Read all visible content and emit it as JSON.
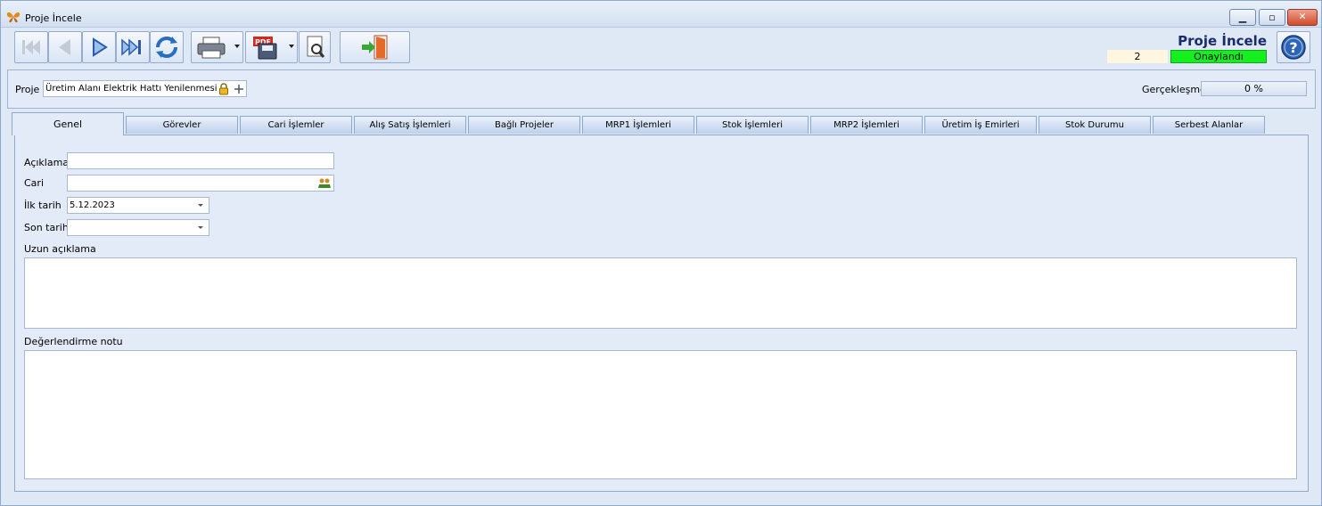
{
  "window": {
    "title": "Proje İncele",
    "icon": "butterfly-icon"
  },
  "toolbar": {
    "buttons": [
      "first-record-icon",
      "prev-record-icon",
      "next-record-icon",
      "last-record-icon",
      "refresh-icon",
      "print-icon",
      "pdf-save-icon",
      "preview-icon",
      "exit-icon"
    ]
  },
  "header": {
    "form_title": "Proje İncele",
    "record_number": "2",
    "status": "Onaylandı",
    "status_color": "#14f01e"
  },
  "project": {
    "label": "Proje",
    "value": "Üretim Alanı Elektrik Hattı Yenilenmesi",
    "progress_label": "Gerçekleşme",
    "progress_value": "0 %"
  },
  "tabs": [
    {
      "label": "Genel",
      "active": true
    },
    {
      "label": "Görevler"
    },
    {
      "label": "Cari İşlemler"
    },
    {
      "label": "Alış Satış İşlemleri"
    },
    {
      "label": "Bağlı Projeler"
    },
    {
      "label": "MRP1 İşlemleri"
    },
    {
      "label": "Stok İşlemleri"
    },
    {
      "label": "MRP2 İşlemleri"
    },
    {
      "label": "Üretim İş Emirleri"
    },
    {
      "label": "Stok Durumu"
    },
    {
      "label": "Serbest Alanlar"
    }
  ],
  "general": {
    "aciklama_label": "Açıklama",
    "aciklama_value": "",
    "cari_label": "Cari",
    "cari_value": "",
    "ilk_tarih_label": "İlk tarih",
    "ilk_tarih_value": "5.12.2023",
    "son_tarih_label": "Son tarih",
    "son_tarih_value": "",
    "uzun_aciklama_label": "Uzun açıklama",
    "degerlendirme_label": "Değerlendirme notu"
  }
}
